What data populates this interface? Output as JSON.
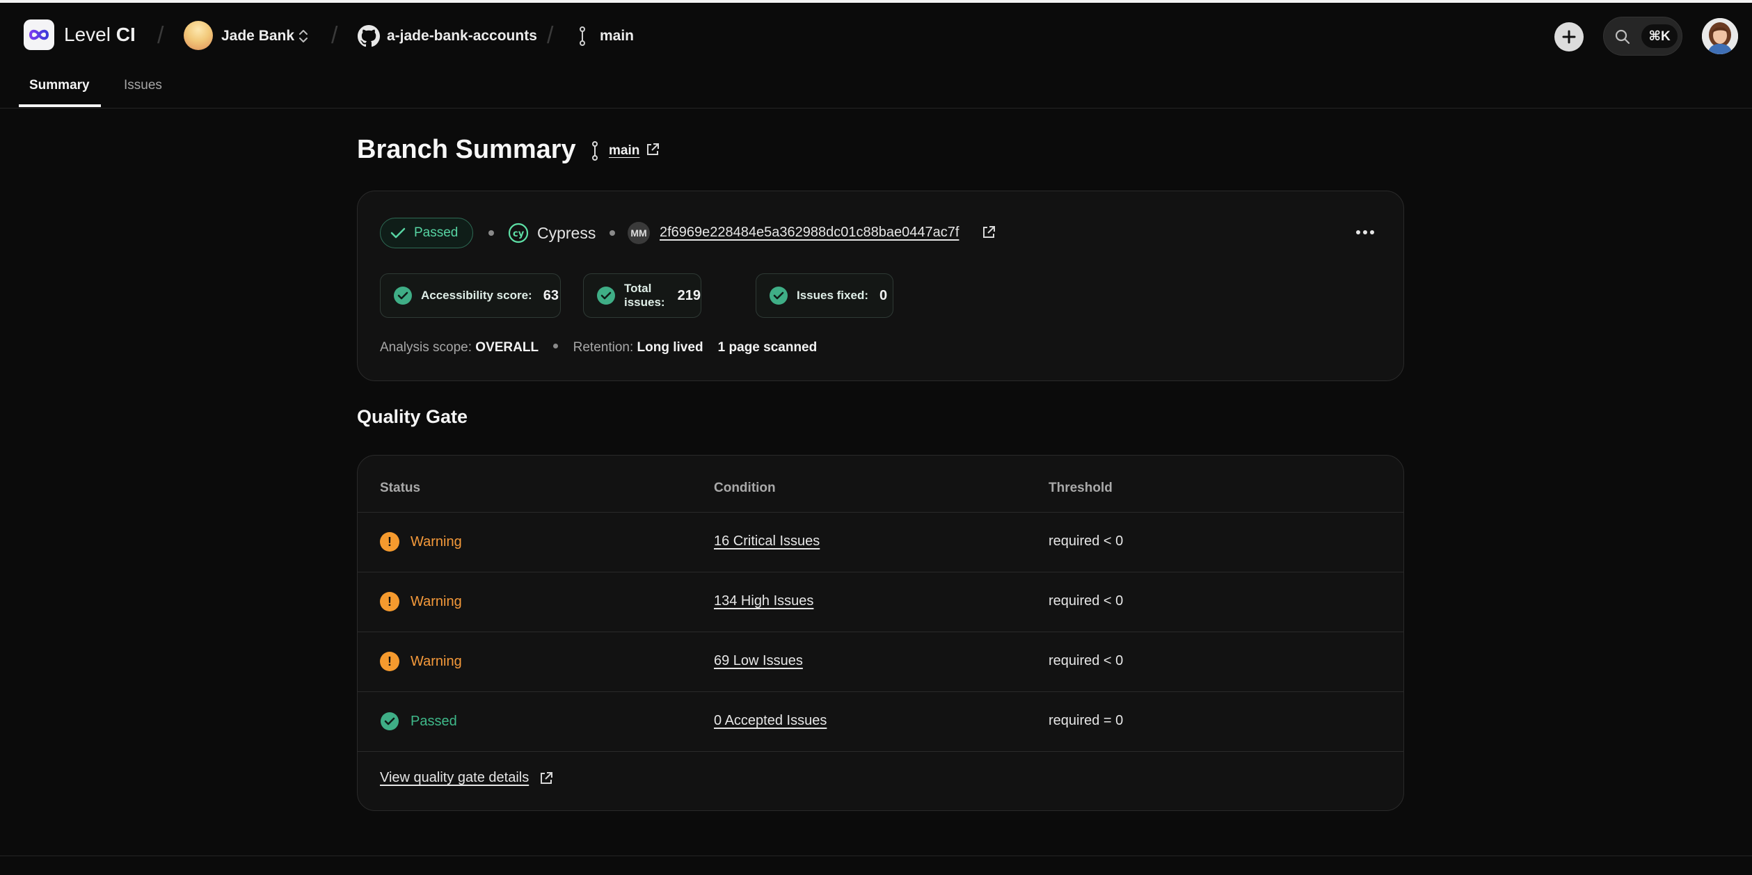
{
  "header": {
    "brand_light": "Level",
    "brand_bold": "CI",
    "org_name": "Jade Bank",
    "repo_name": "a-jade-bank-accounts",
    "branch_name": "main",
    "search_shortcut": "⌘K"
  },
  "tabs": [
    {
      "label": "Summary",
      "active": true
    },
    {
      "label": "Issues",
      "active": false
    }
  ],
  "summary": {
    "title": "Branch Summary",
    "branch_link": "main",
    "status_label": "Passed",
    "ci_provider": "Cypress",
    "author_initials": "MM",
    "commit_sha": "2f6969e228484e5a362988dc01c88bae0447ac7f",
    "metrics": [
      {
        "label": "Accessibility score:",
        "value": "63"
      },
      {
        "label": "Total issues:",
        "value": "219"
      },
      {
        "label": "Issues fixed:",
        "value": "0"
      }
    ],
    "scope_label": "Analysis scope:",
    "scope_value": "OVERALL",
    "retention_label": "Retention:",
    "retention_value": "Long lived",
    "pages_scanned": "1 page scanned"
  },
  "quality_gate": {
    "title": "Quality Gate",
    "columns": [
      "Status",
      "Condition",
      "Threshold"
    ],
    "rows": [
      {
        "status": "Warning",
        "condition": "16 Critical Issues",
        "threshold": "required < 0"
      },
      {
        "status": "Warning",
        "condition": "134 High Issues",
        "threshold": "required < 0"
      },
      {
        "status": "Warning",
        "condition": "69 Low Issues",
        "threshold": "required < 0"
      },
      {
        "status": "Passed",
        "condition": "0 Accepted Issues",
        "threshold": "required = 0"
      }
    ],
    "details_link": "View quality gate details"
  },
  "colors": {
    "background": "#0b0b0b",
    "card": "#121212",
    "passed": "#3fb98a",
    "warning": "#f59a3b"
  }
}
